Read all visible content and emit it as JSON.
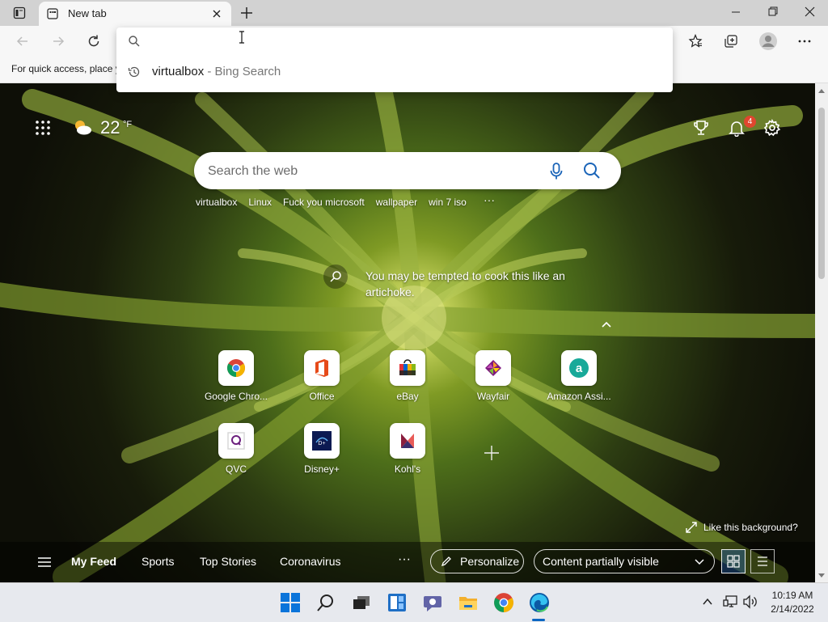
{
  "browser": {
    "tab_title": "New tab",
    "favorites_bar_text": "For quick access, place y"
  },
  "omnibox": {
    "input_value": "",
    "suggestion_query": "virtualbox",
    "suggestion_source": " - Bing Search"
  },
  "ntp": {
    "weather_temp": "22",
    "weather_unit": "°F",
    "notification_count": "4",
    "search_placeholder": "Search the web",
    "trending": [
      "virtualbox",
      "Linux",
      "Fuck you microsoft",
      "wallpaper",
      "win 7 iso"
    ],
    "trending_more": "···",
    "image_caption": "You may be tempted to cook this like an artichoke.",
    "like_background": "Like this background?",
    "tiles": [
      {
        "label": "Google Chro..."
      },
      {
        "label": "Office"
      },
      {
        "label": "eBay"
      },
      {
        "label": "Wayfair"
      },
      {
        "label": "Amazon Assi..."
      },
      {
        "label": "QVC"
      },
      {
        "label": "Disney+"
      },
      {
        "label": "Kohl's"
      }
    ]
  },
  "feed": {
    "items": [
      "My Feed",
      "Sports",
      "Top Stories",
      "Coronavirus"
    ],
    "more": "···",
    "personalize": "Personalize",
    "content_visibility": "Content partially visible"
  },
  "taskbar": {
    "time": "10:19 AM",
    "date": "2/14/2022"
  },
  "colors": {
    "accent": "#0b66c2",
    "badge": "#e0462f",
    "taskbar_bg": "#e7e9ee"
  }
}
